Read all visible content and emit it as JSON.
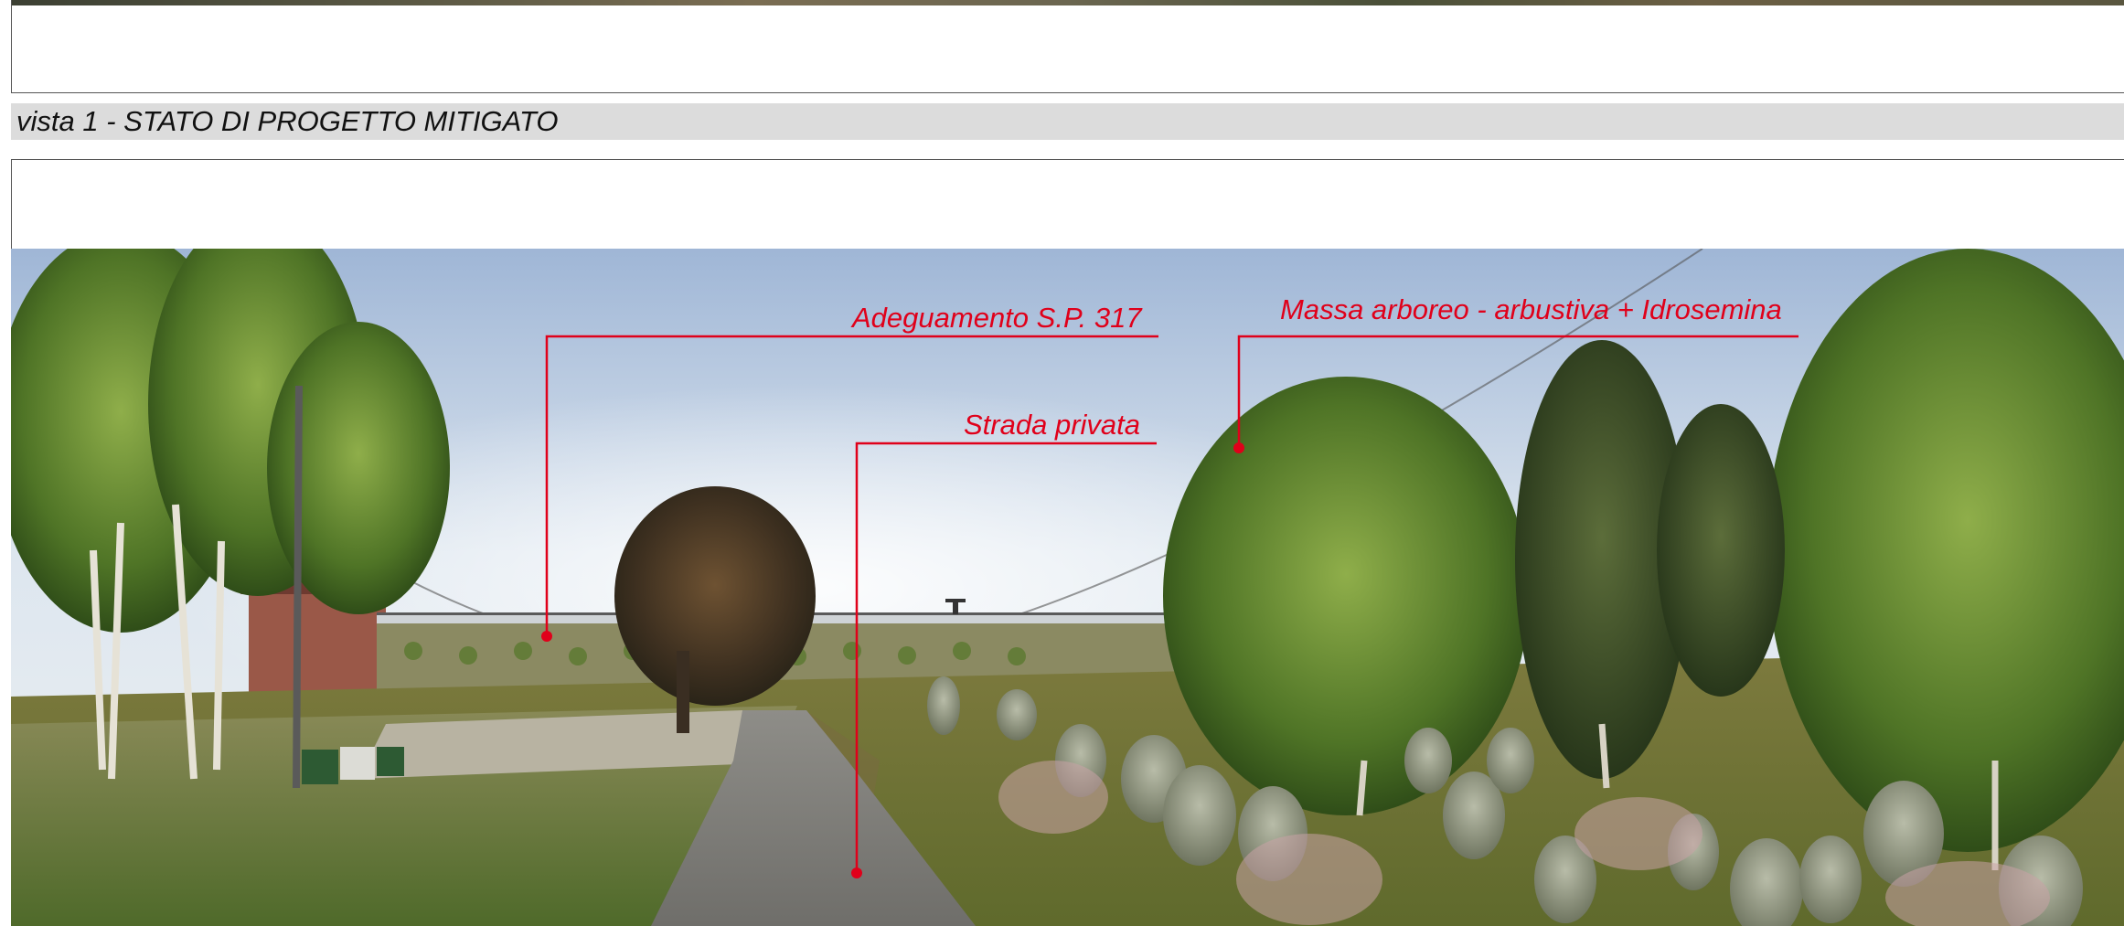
{
  "header": {
    "section_title": "vista 1 - STATO DI PROGETTO MITIGATO"
  },
  "photo": {
    "description_icon": "landscape-photo"
  },
  "callouts": {
    "sp317": "Adeguamento S.P. 317",
    "strada": "Strada privata",
    "massa": "Massa arboreo - arbustiva + Idrosemina"
  },
  "colors": {
    "callout": "#e0001a",
    "section_bar": "#dcdcdc"
  }
}
